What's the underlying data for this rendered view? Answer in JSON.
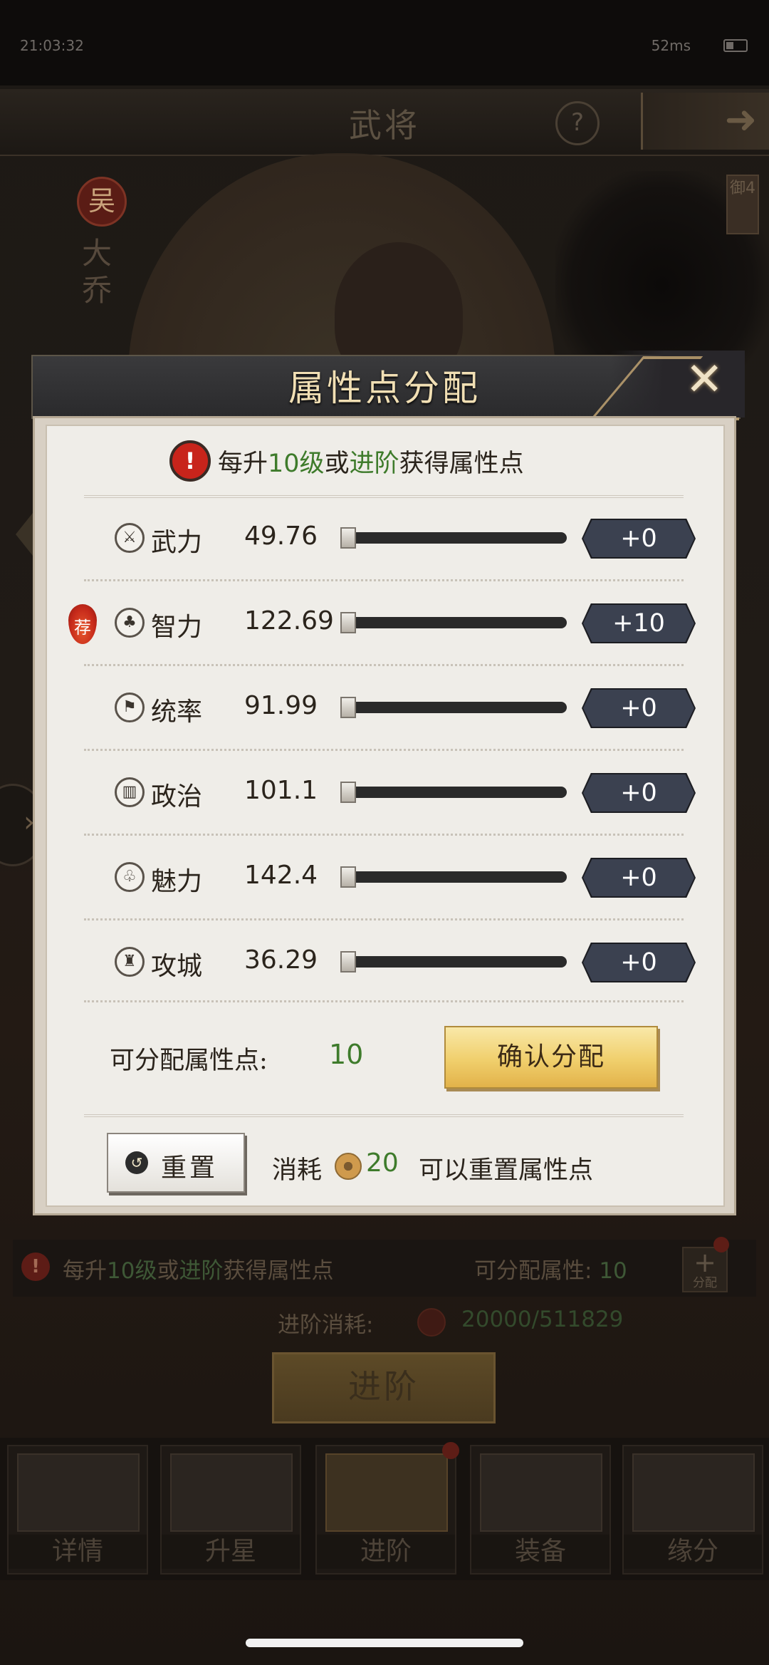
{
  "status_bar": {
    "time": "21:03:32",
    "network": "52ms"
  },
  "background": {
    "header_title": "武将",
    "help": "?",
    "next_arrow": "➜",
    "faction": "吴",
    "hero_name": "大乔",
    "rank_tag": "御4",
    "tip": {
      "prefix": "每升",
      "level": "10级",
      "mid": "或",
      "advance": "进阶",
      "suffix": "获得属性点"
    },
    "alloc": {
      "label": "可分配属性:",
      "value": "10"
    },
    "plus_label": "分配",
    "advance_cost_label": "进阶消耗:",
    "advance_cost_value": "20000/511829",
    "advance_button": "进阶",
    "tabs": [
      {
        "label": "详情"
      },
      {
        "label": "升星"
      },
      {
        "label": "进阶"
      },
      {
        "label": "装备"
      },
      {
        "label": "缘分"
      }
    ]
  },
  "dialog": {
    "title": "属性点分配",
    "tip": {
      "prefix": "每升",
      "level": "10级",
      "mid": "或",
      "advance": "进阶",
      "suffix": "获得属性点"
    },
    "recommend_badge": "荐",
    "attributes": [
      {
        "name": "武力",
        "value": "49.76",
        "add": "+0",
        "icon": "sword-icon"
      },
      {
        "name": "智力",
        "value": "122.69",
        "add": "+10",
        "icon": "club-leaf-icon",
        "recommended": true
      },
      {
        "name": "统率",
        "value": "91.99",
        "add": "+0",
        "icon": "flag-icon"
      },
      {
        "name": "政治",
        "value": "101.1",
        "add": "+0",
        "icon": "scroll-icon"
      },
      {
        "name": "魅力",
        "value": "142.4",
        "add": "+0",
        "icon": "club-icon"
      },
      {
        "name": "攻城",
        "value": "36.29",
        "add": "+0",
        "icon": "castle-icon"
      }
    ],
    "available_label": "可分配属性点:",
    "available_value": "10",
    "confirm_button": "确认分配",
    "reset_button": "重置",
    "consume_label": "消耗",
    "consume_value": "20",
    "consume_tail": "可以重置属性点"
  }
}
